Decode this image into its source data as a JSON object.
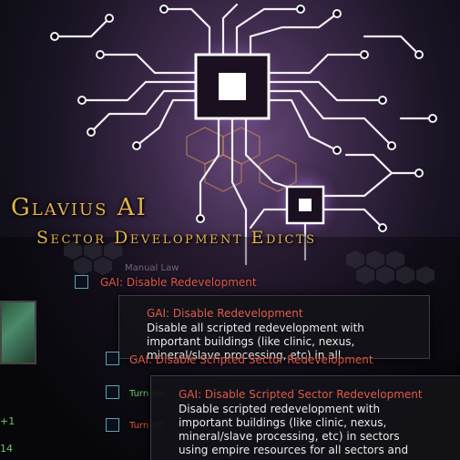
{
  "title": {
    "main": "Glavius AI",
    "sub": "Sector Development Edicts"
  },
  "background_label": "Manual Law",
  "options": [
    {
      "label": "GAI: Disable Redevelopment"
    },
    {
      "label": "GAI: Disable Scripted Sector Redevelopment"
    },
    {
      "label": "Turn on"
    },
    {
      "label": "Turn off"
    }
  ],
  "tooltip1": {
    "title": "GAI: Disable Redevelopment",
    "lines": [
      "Disable all scripted redevelopment with",
      "important buildings (like clinic, nexus,",
      "mineral/slave processing, etc) in all"
    ]
  },
  "tooltip2": {
    "title": "GAI: Disable Scripted Sector Redevelopment",
    "lines": [
      "Disable scripted redevelopment with",
      "important buildings (like clinic, nexus,",
      "mineral/slave processing, etc) in sectors",
      "using empire resources for all sectors and"
    ]
  },
  "left_numbers": [
    "+1",
    "14"
  ],
  "colors": {
    "title": "#e3b24a",
    "option_red": "#e05a4a",
    "tooltip_text": "#ececec",
    "checkbox_border": "#5fa3b3"
  }
}
